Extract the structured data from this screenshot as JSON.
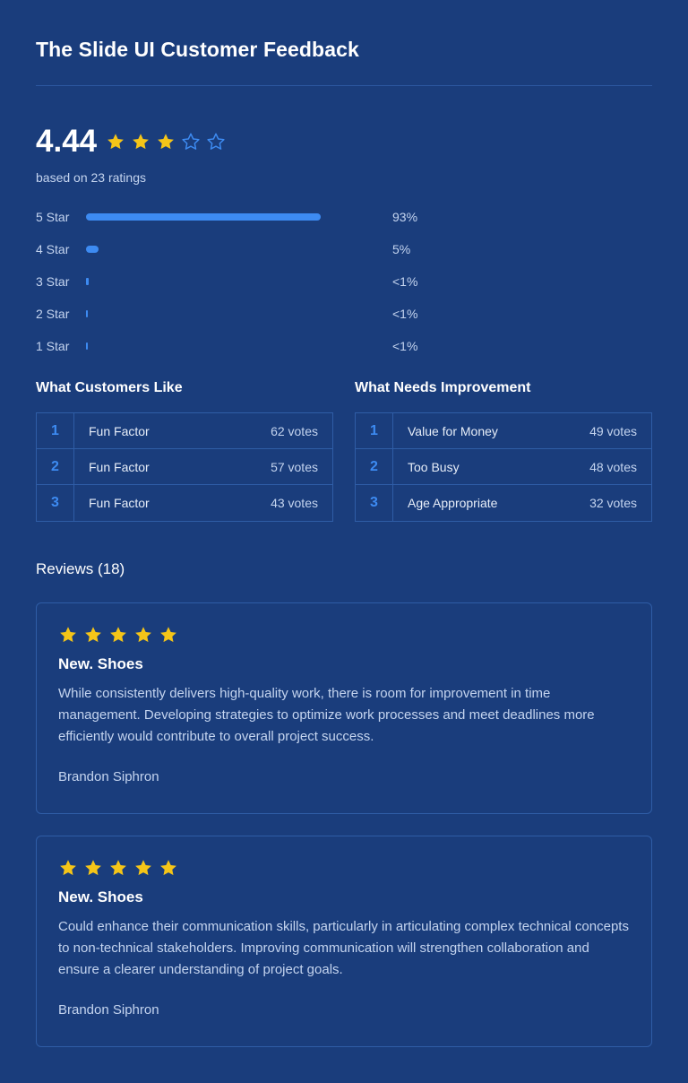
{
  "header": {
    "title": "The Slide UI Customer Feedback"
  },
  "summary": {
    "score": "4.44",
    "stars_filled": 3,
    "stars_total": 5,
    "based_on": "based on 23 ratings"
  },
  "distribution": [
    {
      "label": "5 Star",
      "pct_text": "93%",
      "fill_fraction": 0.93
    },
    {
      "label": "4 Star",
      "pct_text": "5%",
      "fill_fraction": 0.05
    },
    {
      "label": "3 Star",
      "pct_text": "<1%",
      "fill_fraction": 0.01
    },
    {
      "label": "2 Star",
      "pct_text": "<1%",
      "fill_fraction": 0.005
    },
    {
      "label": "1 Star",
      "pct_text": "<1%",
      "fill_fraction": 0.005
    }
  ],
  "likes": {
    "heading": "What Customers Like",
    "rows": [
      {
        "rank": "1",
        "name": "Fun Factor",
        "votes": "62 votes"
      },
      {
        "rank": "2",
        "name": "Fun Factor",
        "votes": "57 votes"
      },
      {
        "rank": "3",
        "name": "Fun Factor",
        "votes": "43 votes"
      }
    ]
  },
  "improvements": {
    "heading": "What Needs Improvement",
    "rows": [
      {
        "rank": "1",
        "name": "Value for Money",
        "votes": "49 votes"
      },
      {
        "rank": "2",
        "name": "Too Busy",
        "votes": "48 votes"
      },
      {
        "rank": "3",
        "name": "Age Appropriate",
        "votes": "32 votes"
      }
    ]
  },
  "reviews": {
    "heading": "Reviews (18)",
    "items": [
      {
        "stars": 5,
        "title": "New. Shoes",
        "body": "While consistently delivers high-quality work, there is room for improvement in time management. Developing strategies to optimize work processes and meet deadlines more efficiently would contribute to overall project success.",
        "author": "Brandon Siphron"
      },
      {
        "stars": 5,
        "title": "New. Shoes",
        "body": "Could enhance their communication skills, particularly in articulating complex technical concepts to non-technical stakeholders. Improving communication will strengthen collaboration and ensure a clearer understanding of project goals.",
        "author": "Brandon Siphron"
      }
    ]
  },
  "colors": {
    "background": "#1a3d7c",
    "accent": "#3d8bf2",
    "star_filled": "#f5c518",
    "star_outline": "#3d8bf2"
  },
  "icons": {
    "star": "star-icon",
    "star_outline": "star-outline-icon"
  }
}
